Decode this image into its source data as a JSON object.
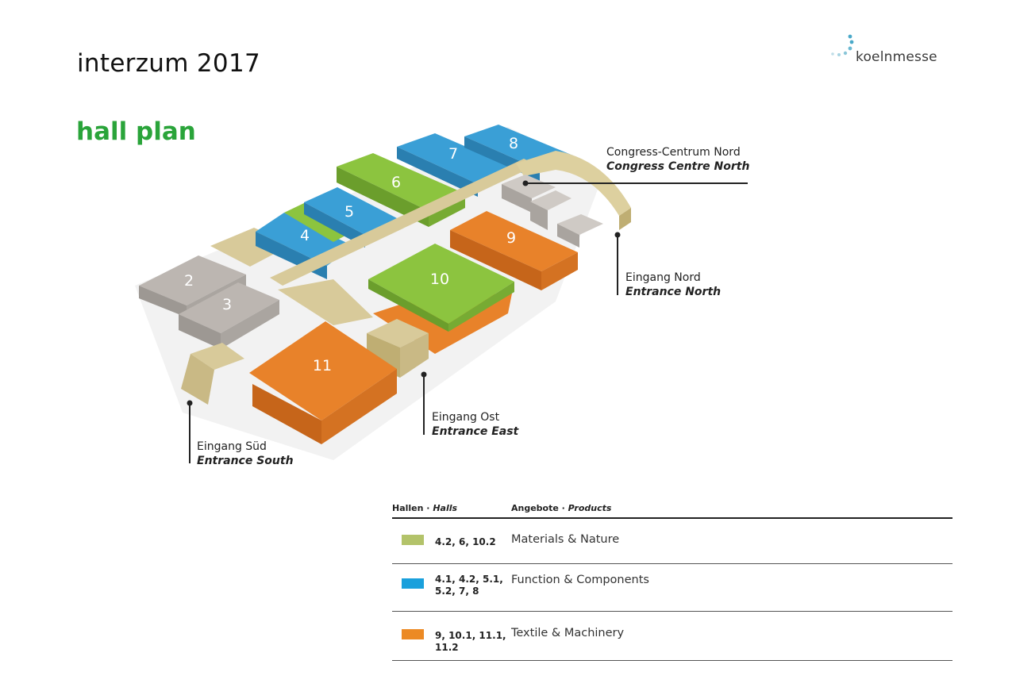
{
  "header": {
    "title": "interzum 2017",
    "subtitle": "hall plan",
    "logo_text": "koelnmesse"
  },
  "colors": {
    "materials": "#8cc43f",
    "function": "#3a9fd6",
    "textile": "#e8822a",
    "neutral": "#b9b3ae",
    "beige": "#d8ca9a",
    "title_green": "#2aa43a"
  },
  "map": {
    "halls": [
      {
        "id": "2",
        "label": "2",
        "category": "neutral"
      },
      {
        "id": "3",
        "label": "3",
        "category": "neutral"
      },
      {
        "id": "4",
        "label": "4",
        "category": "function"
      },
      {
        "id": "5",
        "label": "5",
        "category": "function"
      },
      {
        "id": "6",
        "label": "6",
        "category": "materials"
      },
      {
        "id": "7",
        "label": "7",
        "category": "function"
      },
      {
        "id": "8",
        "label": "8",
        "category": "function"
      },
      {
        "id": "9",
        "label": "9",
        "category": "textile"
      },
      {
        "id": "10",
        "label": "10",
        "category": "materials"
      },
      {
        "id": "11",
        "label": "11",
        "category": "textile"
      }
    ],
    "callouts": {
      "congress": {
        "de": "Congress-Centrum Nord",
        "en": "Congress Centre North"
      },
      "north": {
        "de": "Eingang Nord",
        "en": "Entrance North"
      },
      "east": {
        "de": "Eingang Ost",
        "en": "Entrance East"
      },
      "south": {
        "de": "Eingang Süd",
        "en": "Entrance South"
      }
    }
  },
  "legend": {
    "header_halls_de": "Hallen · ",
    "header_halls_en": "Halls",
    "header_products_de": "Angebote · ",
    "header_products_en": "Products",
    "rows": [
      {
        "halls": "4.2, 6, 10.2",
        "product": "Materials & Nature",
        "color": "#b3c36a"
      },
      {
        "halls": "4.1, 4.2, 5.1, 5.2, 7, 8",
        "product": "Function & Components",
        "color": "#1aa0dc"
      },
      {
        "halls": "9, 10.1, 11.1, 11.2",
        "product": "Textile & Machinery",
        "color": "#ec8a24"
      }
    ]
  }
}
